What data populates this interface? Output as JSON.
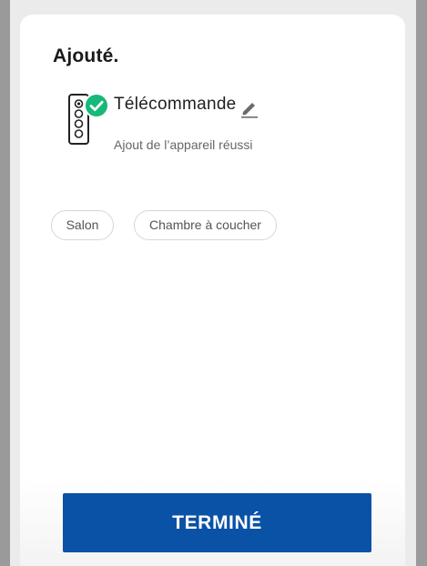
{
  "header": {
    "title": "Ajouté."
  },
  "device": {
    "icon": "remote-control-icon",
    "status_icon": "check-circle-icon",
    "name": "Télécommande",
    "edit_icon": "pencil-icon",
    "status": "Ajout de l’appareil réussi"
  },
  "rooms": [
    {
      "label": "Salon"
    },
    {
      "label": "Chambre à coucher"
    }
  ],
  "footer": {
    "done_label": "TERMINÉ"
  },
  "colors": {
    "accent": "#0a52a5",
    "success": "#17b978",
    "backdrop": "#9a9a9a"
  }
}
